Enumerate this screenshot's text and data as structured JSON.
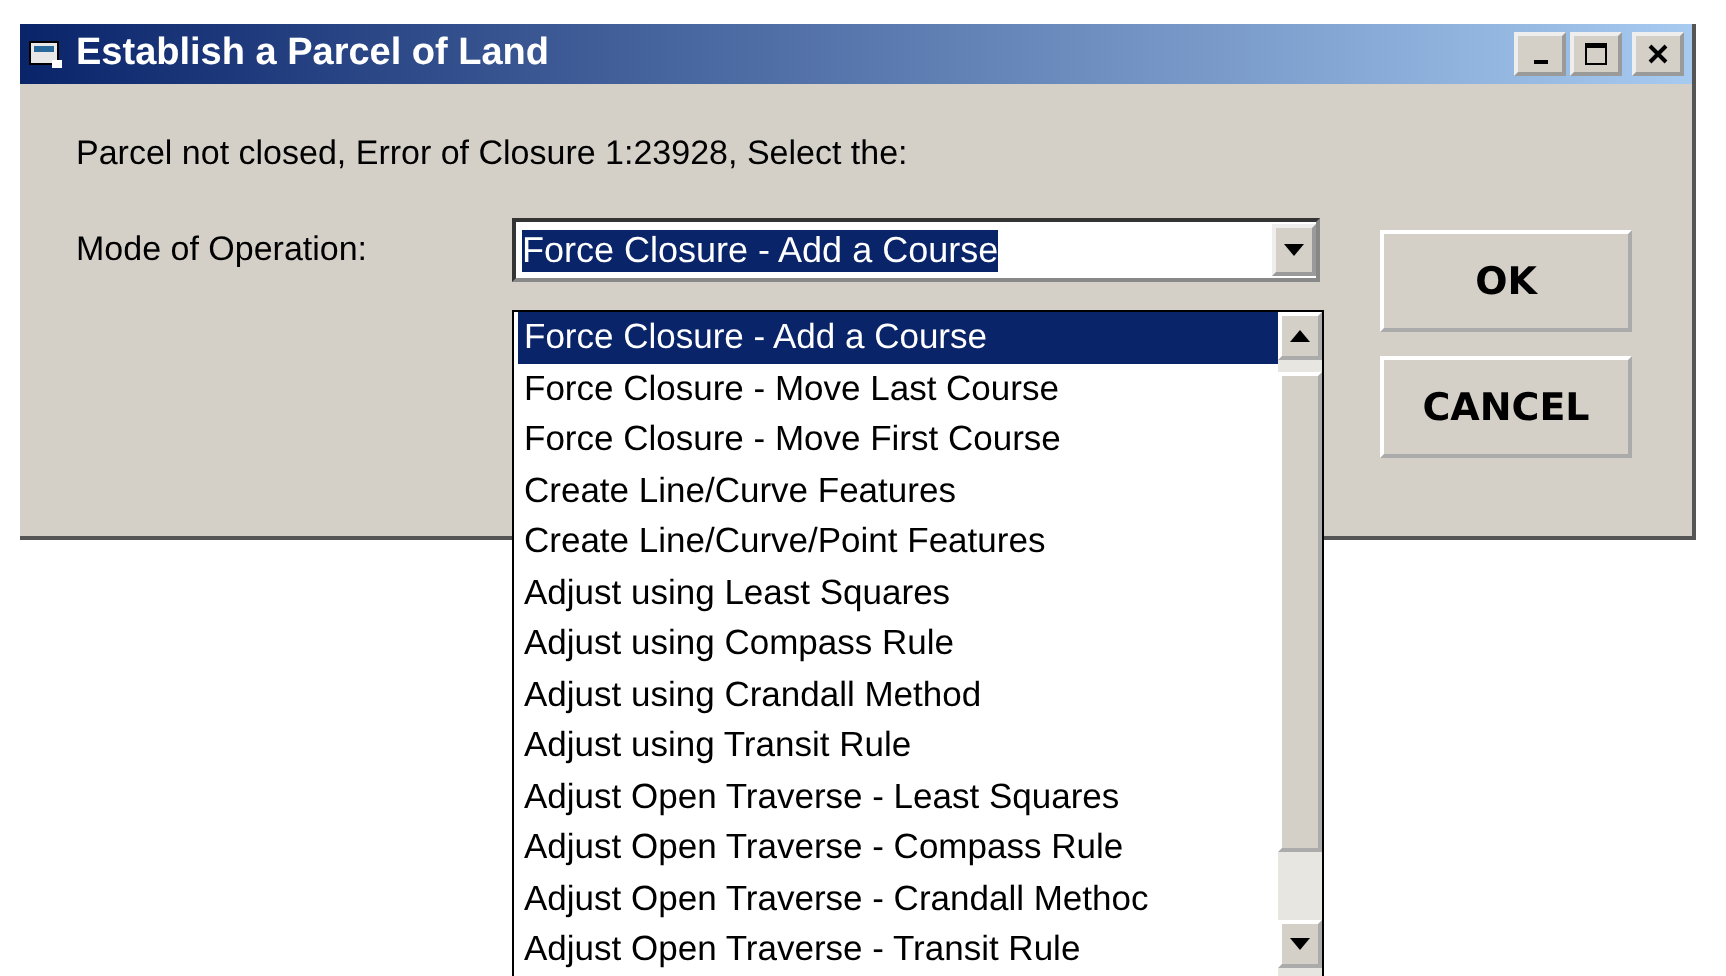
{
  "window": {
    "title": "Establish a Parcel of Land"
  },
  "message": "Parcel not closed, Error of Closure 1:23928, Select the:",
  "mode_label": "Mode of Operation:",
  "combo": {
    "value": "Force Closure - Add a Course"
  },
  "buttons": [
    "OK",
    "CANCEL"
  ],
  "options": [
    {
      "label": "Force Closure - Add a Course",
      "selected": true
    },
    {
      "label": "Force Closure - Move Last Course",
      "selected": false
    },
    {
      "label": "Force Closure - Move First Course",
      "selected": false
    },
    {
      "label": "Create Line/Curve Features",
      "selected": false
    },
    {
      "label": "Create Line/Curve/Point Features",
      "selected": false
    },
    {
      "label": "Adjust using Least Squares",
      "selected": false
    },
    {
      "label": "Adjust using Compass Rule",
      "selected": false
    },
    {
      "label": "Adjust using Crandall Method",
      "selected": false
    },
    {
      "label": "Adjust using Transit Rule",
      "selected": false
    },
    {
      "label": "Adjust Open Traverse - Least Squares",
      "selected": false
    },
    {
      "label": "Adjust Open Traverse - Compass Rule",
      "selected": false
    },
    {
      "label": "Adjust Open Traverse - Crandall Methoc",
      "selected": false
    },
    {
      "label": "Adjust Open Traverse - Transit Rule",
      "selected": false
    }
  ]
}
